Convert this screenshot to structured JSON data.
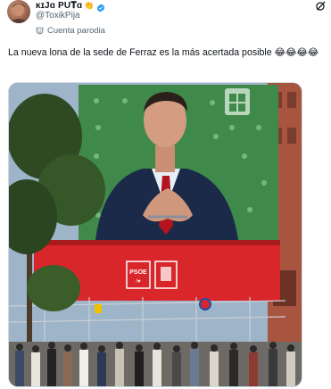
{
  "author": {
    "display_name": "ĸɪJɑ PU𝐓ɑ",
    "name_emoji": "👏",
    "handle": "@ToxikPija",
    "parody_label": "Cuenta parodia"
  },
  "tweet": {
    "text": "La nueva lona de la sede de Ferraz es la más acertada posible 😂😂😂😂"
  },
  "media": {
    "alt_banner_logo": "PSOE",
    "colors": {
      "banner_green": "#3f8a4a",
      "banner_red": "#d9262b",
      "brand_blue": "#1d9bf0",
      "muted": "#536471"
    }
  },
  "icons": {
    "verified": "verified-badge-icon",
    "parody": "parody-mask-icon",
    "grok": "grok-icon"
  }
}
